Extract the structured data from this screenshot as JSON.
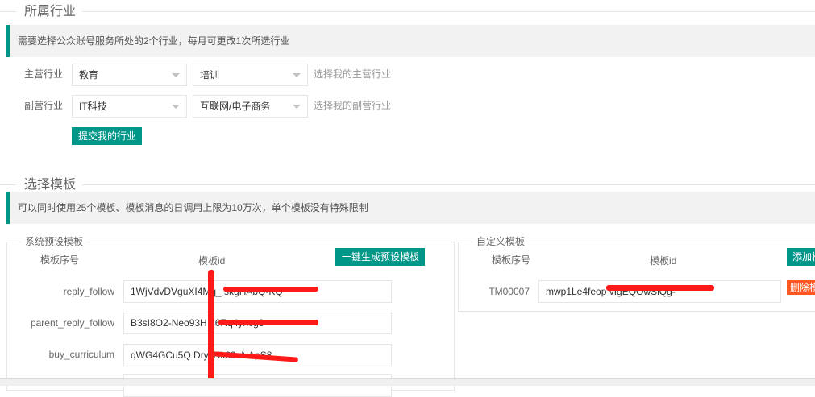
{
  "industry": {
    "title": "所属行业",
    "notice": "需要选择公众账号服务所处的2个行业，每月可更改1次所选行业",
    "primary": {
      "label": "主营行业",
      "category": "教育",
      "sub": "培训",
      "hint": "选择我的主营行业"
    },
    "secondary": {
      "label": "副营行业",
      "category": "IT科技",
      "sub": "互联网/电子商务",
      "hint": "选择我的副营行业"
    },
    "submit_label": "提交我的行业"
  },
  "templates": {
    "title": "选择模板",
    "notice": "可以同时使用25个模板、模板消息的日调用上限为10万次，单个模板没有特殊限制",
    "system": {
      "legend": "系统预设模板",
      "col_seq": "模板序号",
      "col_id": "模板id",
      "generate_label": "一键生成预设模板",
      "rows": [
        {
          "name": "reply_follow",
          "id": "1WjVdvDVguXI4Mq_              skgHAbQ-KQ"
        },
        {
          "name": "parent_reply_follow",
          "id": "B3sI8O2-Neo93H              36Rq4yncg8"
        },
        {
          "name": "buy_curriculum",
          "id": "qWG4GCu5Q              DryyNk89uNApS8"
        }
      ]
    },
    "custom": {
      "legend": "自定义模板",
      "col_seq": "模板序号",
      "col_id": "模板id",
      "add_label": "添加模板",
      "rows": [
        {
          "name": "TM00007",
          "id": "mwp1Le4feop              vIgEQOwSlQg-",
          "delete_label": "删除模板"
        }
      ]
    }
  }
}
